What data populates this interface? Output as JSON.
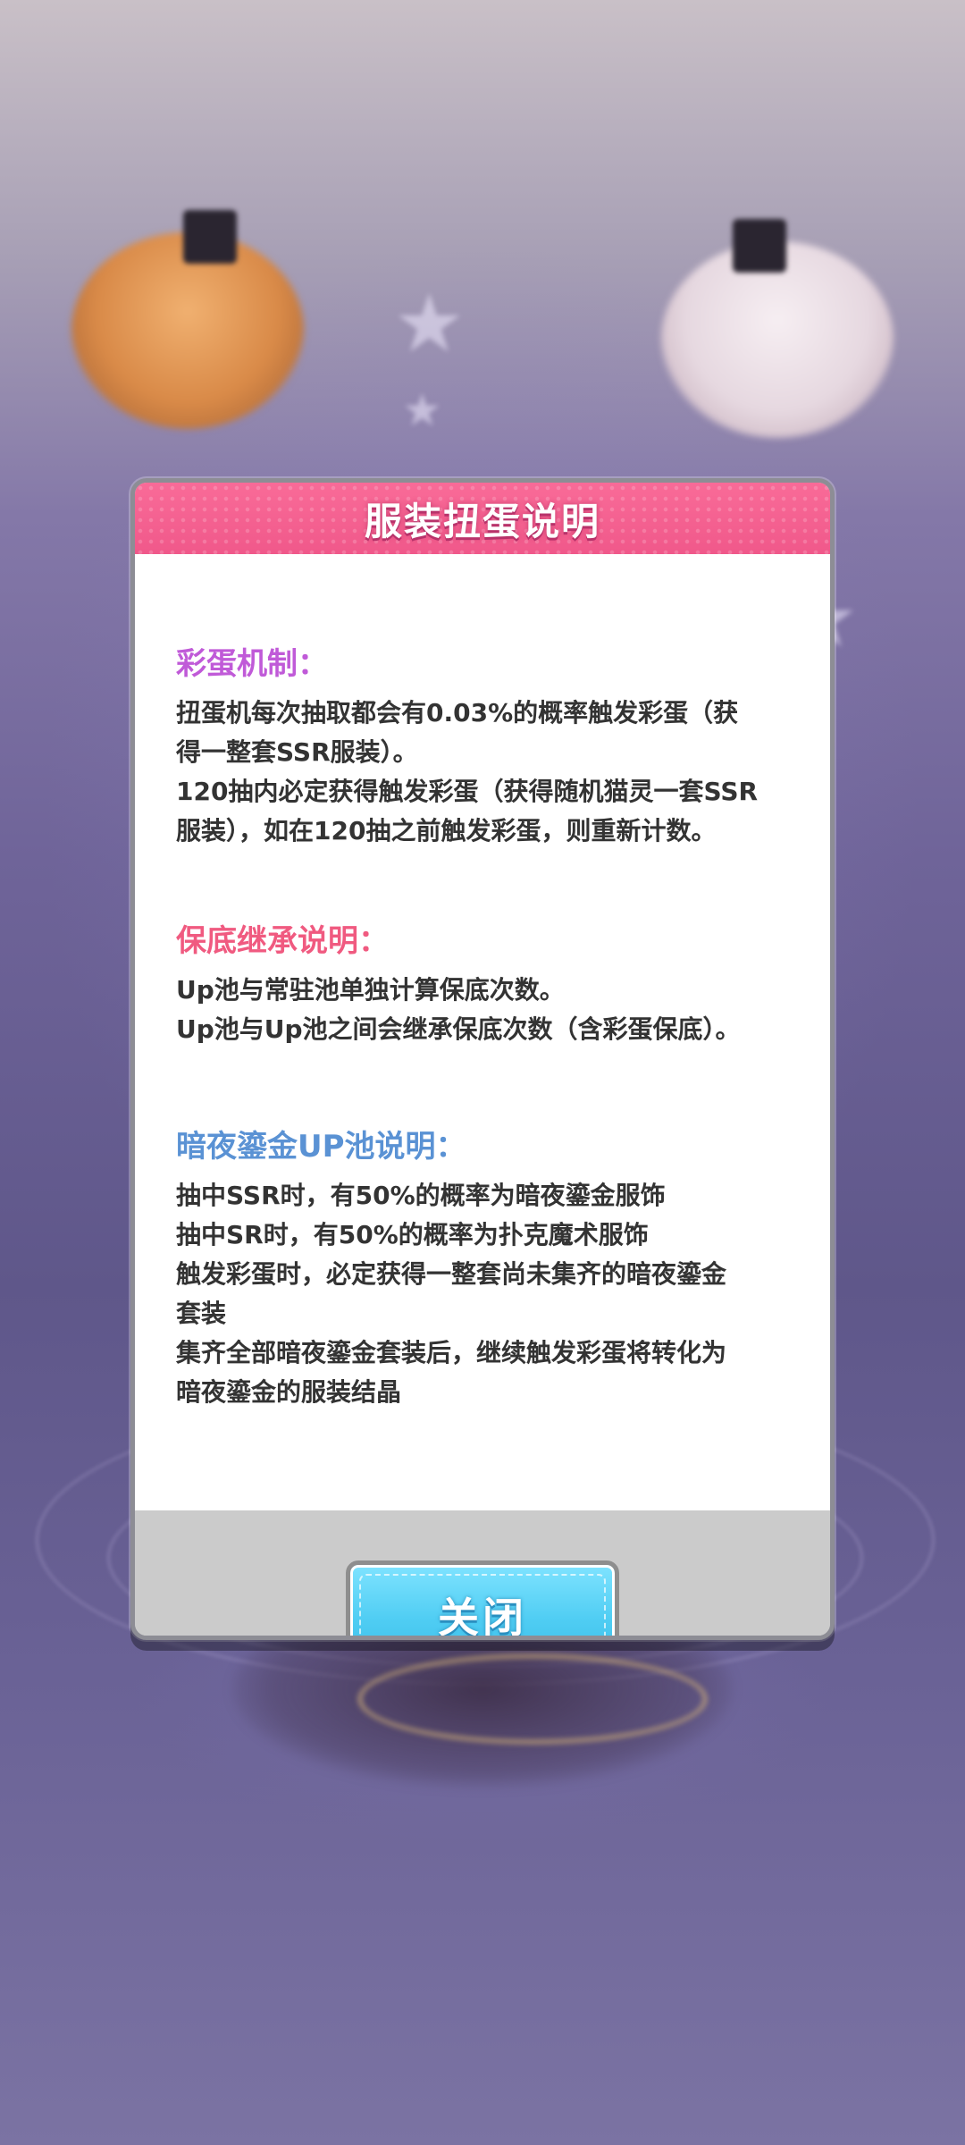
{
  "dialog": {
    "title": "服装扭蛋说明",
    "close_label": "关闭"
  },
  "sections": {
    "easter_egg": {
      "heading": "彩蛋机制：",
      "lines": [
        "扭蛋机每次抽取都会有0.03%的概率触发彩蛋（获",
        "得一整套SSR服装）。",
        "120抽内必定获得触发彩蛋（获得随机猫灵一套SSR",
        "服装），如在120抽之前触发彩蛋，则重新计数。"
      ]
    },
    "pity": {
      "heading": "保底继承说明：",
      "lines": [
        "Up池与常驻池单独计算保底次数。",
        "Up池与Up池之间会继承保底次数（含彩蛋保底）。"
      ]
    },
    "up_pool": {
      "heading": "暗夜鎏金UP池说明：",
      "lines": [
        "抽中SSR时，有50%的概率为暗夜鎏金服饰",
        "抽中SR时，有50%的概率为扑克魔术服饰",
        "触发彩蛋时，必定获得一整套尚未集齐的暗夜鎏金",
        "套装",
        "集齐全部暗夜鎏金套装后，继续触发彩蛋将转化为",
        "暗夜鎏金的服装结晶"
      ]
    }
  },
  "colors": {
    "header_pink": "#f0588a",
    "egg_heading": "#c05ad8",
    "pity_heading": "#f05a80",
    "up_heading": "#5a92d4",
    "button_blue": "#4fcdf3"
  }
}
